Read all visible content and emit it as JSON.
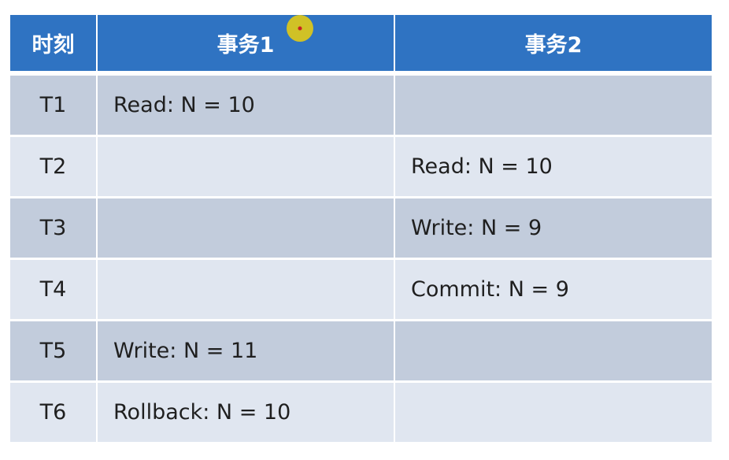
{
  "table": {
    "headers": {
      "time": "时刻",
      "tx1": "事务1",
      "tx2": "事务2"
    },
    "rows": [
      {
        "time": "T1",
        "tx1": "Read: N = 10",
        "tx2": ""
      },
      {
        "time": "T2",
        "tx1": "",
        "tx2": "Read: N = 10"
      },
      {
        "time": "T3",
        "tx1": "",
        "tx2": "Write: N = 9"
      },
      {
        "time": "T4",
        "tx1": "",
        "tx2": "Commit: N = 9"
      },
      {
        "time": "T5",
        "tx1": "Write: N = 11",
        "tx2": ""
      },
      {
        "time": "T6",
        "tx1": "Rollback: N = 10",
        "tx2": ""
      }
    ]
  },
  "colors": {
    "header_bg": "#2f73c2",
    "row_dark": "#c2ccdc",
    "row_light": "#e0e6f0",
    "pointer": "#d8c51e"
  }
}
